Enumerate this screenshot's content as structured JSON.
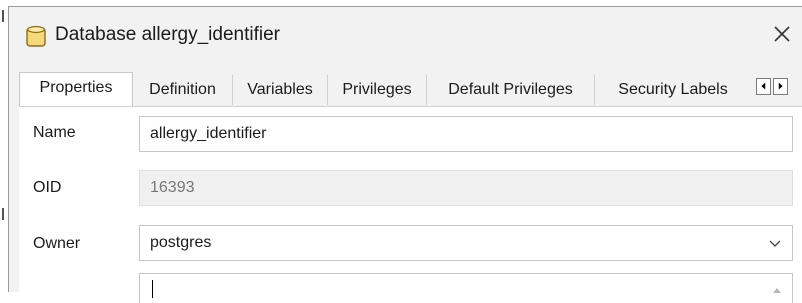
{
  "window": {
    "title": "Database allergy_identifier",
    "icon": "database-icon",
    "close_icon": "close-icon"
  },
  "tabs": [
    {
      "label": "Properties",
      "active": true
    },
    {
      "label": "Definition",
      "active": false
    },
    {
      "label": "Variables",
      "active": false
    },
    {
      "label": "Privileges",
      "active": false
    },
    {
      "label": "Default Privileges",
      "active": false
    },
    {
      "label": "Security Labels",
      "active": false
    }
  ],
  "tab_scroll": {
    "left_icon": "triangle-left-icon",
    "right_icon": "triangle-right-icon"
  },
  "form": {
    "name_label": "Name",
    "name_value": "allergy_identifier",
    "oid_label": "OID",
    "oid_value": "16393",
    "owner_label": "Owner",
    "owner_value": "postgres",
    "comment_value": ""
  },
  "colors": {
    "dialog_bg": "#f2f2f2",
    "panel_bg": "#ffffff",
    "db_icon_fill": "#f5d97a",
    "db_icon_stroke": "#8a6d1f"
  }
}
